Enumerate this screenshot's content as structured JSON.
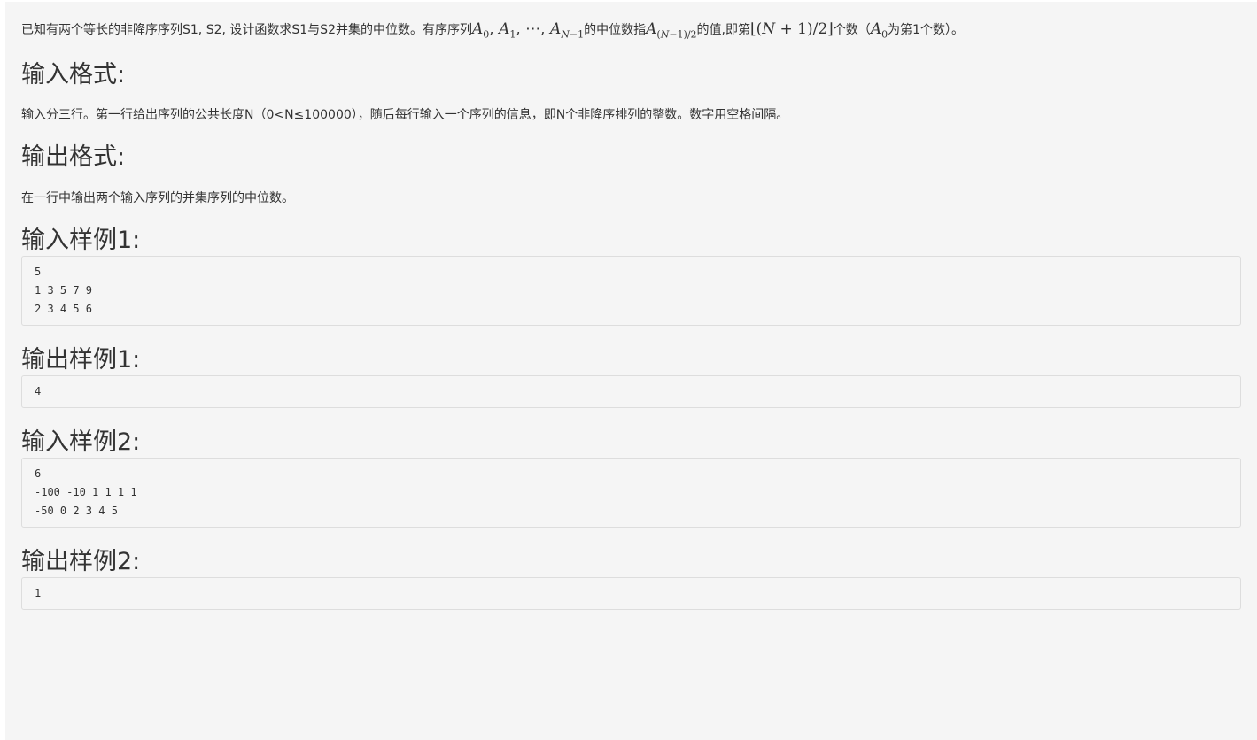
{
  "problem": {
    "intro": {
      "before": "已知有两个等长的非降序序列S1, S2, 设计函数求S1与S2并集的中位数。有序序列",
      "seq_math": "A₀, A₁, ⋯, A_N−1",
      "mid1": "的中位数指",
      "median_math": "A_(N−1)/2",
      "mid2": "的值,即第",
      "index_math": "⌊(N+1)/2⌋",
      "mid3": "个数（",
      "a0_math": "A₀",
      "after": "为第1个数）。"
    },
    "input_format": {
      "heading": "输入格式:",
      "text": "输入分三行。第一行给出序列的公共长度N（0<N≤100000），随后每行输入一个序列的信息，即N个非降序排列的整数。数字用空格间隔。"
    },
    "output_format": {
      "heading": "输出格式:",
      "text": "在一行中输出两个输入序列的并集序列的中位数。"
    },
    "samples": [
      {
        "input_heading": "输入样例1:",
        "input": "5\n1 3 5 7 9\n2 3 4 5 6",
        "output_heading": "输出样例1:",
        "output": "4"
      },
      {
        "input_heading": "输入样例2:",
        "input": "6\n-100 -10 1 1 1 1\n-50 0 2 3 4 5",
        "output_heading": "输出样例2:",
        "output": "1"
      }
    ]
  }
}
